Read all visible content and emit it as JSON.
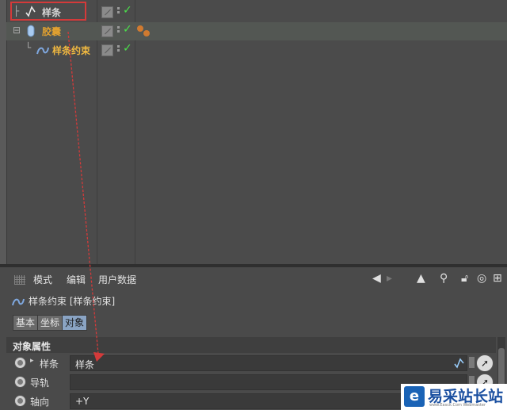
{
  "object_manager": {
    "rows": [
      {
        "name": "样条",
        "name_color": "#d8d8d8",
        "prefix": "├"
      },
      {
        "name": "胶囊",
        "name_color": "#e0a030",
        "prefix": "⊟"
      },
      {
        "name": "样条约束",
        "name_color": "#f0b840",
        "prefix": "└"
      }
    ]
  },
  "attribute_manager": {
    "menu": [
      "模式",
      "编辑",
      "用户数据"
    ],
    "object_title": "样条约束 [样条约束]",
    "tabs": [
      {
        "label": "基本",
        "active": false
      },
      {
        "label": "坐标",
        "active": false
      },
      {
        "label": "对象",
        "active": true
      }
    ],
    "section_title": "对象属性",
    "properties": [
      {
        "label": "样条",
        "value": "样条"
      },
      {
        "label": "导轨",
        "value": ""
      },
      {
        "label": "轴向",
        "value": "+Y"
      }
    ]
  },
  "watermark": {
    "logo": "e",
    "text": "易采站长站",
    "sub": "www.Easck.Com Webmaster"
  },
  "icons": {
    "spline": "spline-icon",
    "capsule": "capsule-icon",
    "spline_wrap": "spline-wrap-icon",
    "tag": "material-tag-icon"
  },
  "colors": {
    "check": "#4be04b",
    "annotation": "#d43a3a",
    "active_tab": "#8aa4c4"
  }
}
